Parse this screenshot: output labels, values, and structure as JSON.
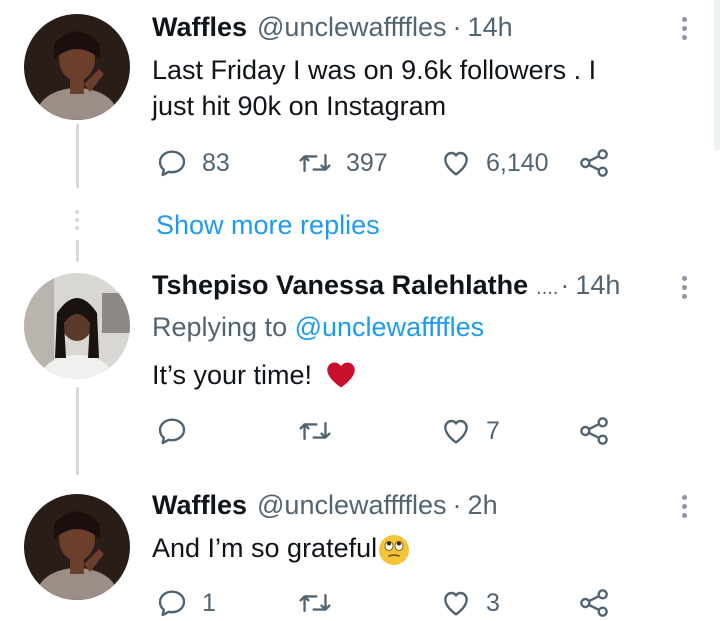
{
  "tweets": [
    {
      "name": "Waffles",
      "handle": "@unclewaffffles",
      "time": "14h",
      "text_line1": "Last  Friday I was on 9.6k followers . I",
      "text_line2": "just hit 90k on Instagram",
      "replies": "83",
      "retweets": "397",
      "likes": "6,140"
    },
    {
      "name": "Tshepiso Vanessa Ralehlathe",
      "name_ellipsis": "....",
      "time": "14h",
      "replying_prefix": "Replying to",
      "replying_handle": "@unclewaffffles",
      "text": "It’s your time!",
      "replies": "",
      "retweets": "",
      "likes": "7"
    },
    {
      "name": "Waffles",
      "handle": "@unclewaffffles",
      "time": "2h",
      "text": "And I’m so grateful",
      "replies": "1",
      "retweets": "",
      "likes": "3"
    }
  ],
  "show_more_replies": "Show more replies",
  "separator": "·",
  "icons": {
    "reply": "reply-icon",
    "retweet": "retweet-icon",
    "like": "heart-icon",
    "share": "share-icon",
    "more": "more-vertical-icon",
    "emoji_heart": "red-heart-emoji",
    "emoji_face": "rolling-eyes-emoji"
  },
  "colors": {
    "link": "#1d9bf0",
    "muted": "#536471",
    "heart": "#c8102e"
  }
}
